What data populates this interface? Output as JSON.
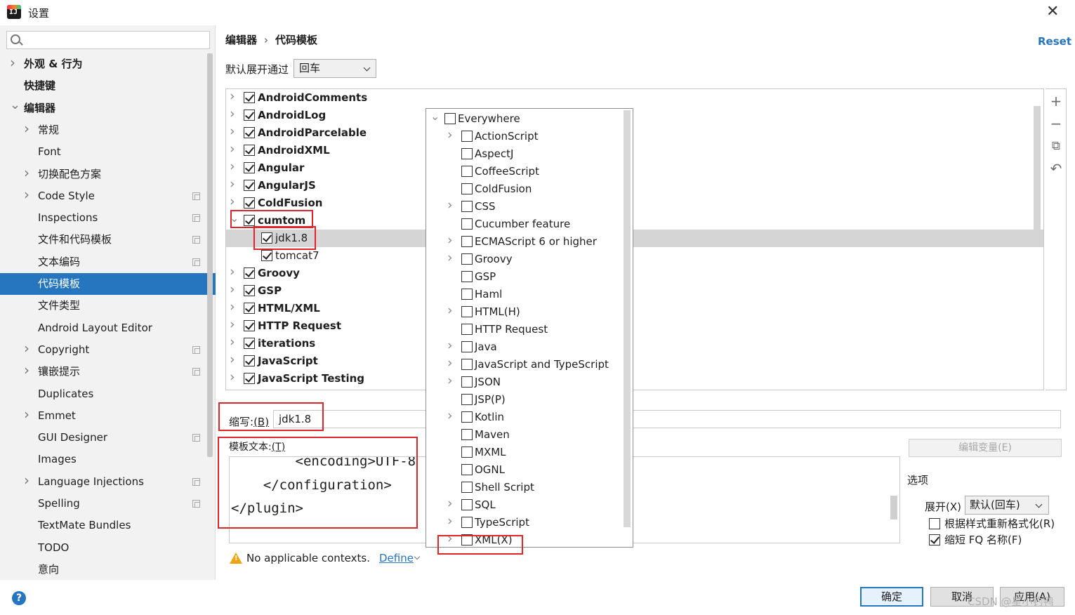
{
  "window": {
    "title": "设置",
    "app_icon_text": "IJ"
  },
  "sidebar": {
    "search": {
      "value": "",
      "placeholder": ""
    },
    "items": [
      {
        "label": "外观 & 行为",
        "expandable": true,
        "expanded": false,
        "level": 0,
        "bold": true,
        "copy": false
      },
      {
        "label": "快捷键",
        "expandable": false,
        "level": 0,
        "bold": true,
        "copy": false
      },
      {
        "label": "编辑器",
        "expandable": true,
        "expanded": true,
        "level": 0,
        "bold": true,
        "copy": false
      },
      {
        "label": "常规",
        "expandable": true,
        "level": 1,
        "copy": false
      },
      {
        "label": "Font",
        "expandable": false,
        "level": 1,
        "copy": false
      },
      {
        "label": "切换配色方案",
        "expandable": true,
        "level": 1,
        "copy": false
      },
      {
        "label": "Code Style",
        "expandable": true,
        "level": 1,
        "copy": true
      },
      {
        "label": "Inspections",
        "expandable": false,
        "level": 1,
        "copy": true
      },
      {
        "label": "文件和代码模板",
        "expandable": false,
        "level": 1,
        "copy": true
      },
      {
        "label": "文本编码",
        "expandable": false,
        "level": 1,
        "copy": true
      },
      {
        "label": "代码模板",
        "expandable": false,
        "level": 1,
        "copy": false,
        "selected": true
      },
      {
        "label": "文件类型",
        "expandable": false,
        "level": 1,
        "copy": false
      },
      {
        "label": "Android Layout Editor",
        "expandable": false,
        "level": 1,
        "copy": false
      },
      {
        "label": "Copyright",
        "expandable": true,
        "level": 1,
        "copy": true
      },
      {
        "label": "镶嵌提示",
        "expandable": true,
        "level": 1,
        "copy": true
      },
      {
        "label": "Duplicates",
        "expandable": false,
        "level": 1,
        "copy": false
      },
      {
        "label": "Emmet",
        "expandable": true,
        "level": 1,
        "copy": false
      },
      {
        "label": "GUI Designer",
        "expandable": false,
        "level": 1,
        "copy": true
      },
      {
        "label": "Images",
        "expandable": false,
        "level": 1,
        "copy": false
      },
      {
        "label": "Language Injections",
        "expandable": true,
        "level": 1,
        "copy": true
      },
      {
        "label": "Spelling",
        "expandable": false,
        "level": 1,
        "copy": true
      },
      {
        "label": "TextMate Bundles",
        "expandable": false,
        "level": 1,
        "copy": false
      },
      {
        "label": "TODO",
        "expandable": false,
        "level": 1,
        "copy": false
      },
      {
        "label": "意向",
        "expandable": false,
        "level": 1,
        "copy": false
      }
    ]
  },
  "breadcrumb": {
    "part1": "编辑器",
    "separator": "›",
    "part2": "代码模板"
  },
  "reset_label": "Reset",
  "expand_by": {
    "label": "默认展开通过",
    "value": "回车"
  },
  "template_tree": [
    {
      "name": "AndroidComments",
      "type": "group",
      "checked": true
    },
    {
      "name": "AndroidLog",
      "type": "group",
      "checked": true
    },
    {
      "name": "AndroidParcelable",
      "type": "group",
      "checked": true
    },
    {
      "name": "AndroidXML",
      "type": "group",
      "checked": true
    },
    {
      "name": "Angular",
      "type": "group",
      "checked": true
    },
    {
      "name": "AngularJS",
      "type": "group",
      "checked": true
    },
    {
      "name": "ColdFusion",
      "type": "group",
      "checked": true
    },
    {
      "name": "cumtom",
      "type": "group",
      "checked": true,
      "expanded": true
    },
    {
      "name": "jdk1.8",
      "type": "item",
      "checked": true,
      "highlight": true
    },
    {
      "name": "tomcat7",
      "type": "item",
      "checked": true
    },
    {
      "name": "Groovy",
      "type": "group",
      "checked": true
    },
    {
      "name": "GSP",
      "type": "group",
      "checked": true
    },
    {
      "name": "HTML/XML",
      "type": "group",
      "checked": true
    },
    {
      "name": "HTTP Request",
      "type": "group",
      "checked": true
    },
    {
      "name": "iterations",
      "type": "group",
      "checked": true
    },
    {
      "name": "JavaScript",
      "type": "group",
      "checked": true
    },
    {
      "name": "JavaScript Testing",
      "type": "group",
      "checked": true
    }
  ],
  "tools": {
    "add": "+",
    "remove": "−",
    "copy": "⧉",
    "revert": "↶"
  },
  "abbreviation": {
    "label": "缩写:",
    "mnemonic": "(B)",
    "value": "jdk1.8"
  },
  "template_text": {
    "label": "模板文本:",
    "mnemonic": "(T)",
    "lines": [
      "        <encoding>UTF-8",
      "    </configuration>",
      "</plugin>"
    ]
  },
  "edit_variables_label": "编辑变量(E)",
  "options": {
    "title": "选项",
    "expand_label": "展开(X)",
    "expand_value": "默认(回车)",
    "reformat_label": "根据样式重新格式化(R)",
    "reformat_checked": false,
    "shorten_label": "缩短 FQ 名称(F)",
    "shorten_checked": true
  },
  "warning": {
    "text": "No applicable contexts.",
    "define_label": "Define"
  },
  "contexts": [
    {
      "name": "Everywhere",
      "expandable": true,
      "expanded": true,
      "level": 0
    },
    {
      "name": "ActionScript",
      "expandable": true,
      "level": 1
    },
    {
      "name": "AspectJ",
      "expandable": false,
      "level": 1
    },
    {
      "name": "CoffeeScript",
      "expandable": false,
      "level": 1
    },
    {
      "name": "ColdFusion",
      "expandable": false,
      "level": 1
    },
    {
      "name": "CSS",
      "expandable": true,
      "level": 1
    },
    {
      "name": "Cucumber feature",
      "expandable": false,
      "level": 1
    },
    {
      "name": "ECMAScript 6 or higher",
      "expandable": true,
      "level": 1
    },
    {
      "name": "Groovy",
      "expandable": true,
      "level": 1
    },
    {
      "name": "GSP",
      "expandable": false,
      "level": 1
    },
    {
      "name": "Haml",
      "expandable": false,
      "level": 1
    },
    {
      "name": "HTML(H)",
      "expandable": true,
      "level": 1
    },
    {
      "name": "HTTP Request",
      "expandable": false,
      "level": 1
    },
    {
      "name": "Java",
      "expandable": true,
      "level": 1
    },
    {
      "name": "JavaScript and TypeScript",
      "expandable": true,
      "level": 1
    },
    {
      "name": "JSON",
      "expandable": true,
      "level": 1
    },
    {
      "name": "JSP(P)",
      "expandable": false,
      "level": 1
    },
    {
      "name": "Kotlin",
      "expandable": true,
      "level": 1
    },
    {
      "name": "Maven",
      "expandable": false,
      "level": 1
    },
    {
      "name": "MXML",
      "expandable": false,
      "level": 1
    },
    {
      "name": "OGNL",
      "expandable": false,
      "level": 1
    },
    {
      "name": "Shell Script",
      "expandable": false,
      "level": 1
    },
    {
      "name": "SQL",
      "expandable": true,
      "level": 1
    },
    {
      "name": "TypeScript",
      "expandable": true,
      "level": 1
    },
    {
      "name": "XML(X)",
      "expandable": true,
      "level": 1
    }
  ],
  "footer": {
    "help": "?",
    "ok": "确定",
    "cancel": "取消",
    "apply": "应用(A)",
    "watermark": "CSDN @星小钓鸭"
  },
  "colors": {
    "accent": "#2675bf",
    "annotation_red": "#e0242c",
    "warning": "#f0a30a"
  }
}
